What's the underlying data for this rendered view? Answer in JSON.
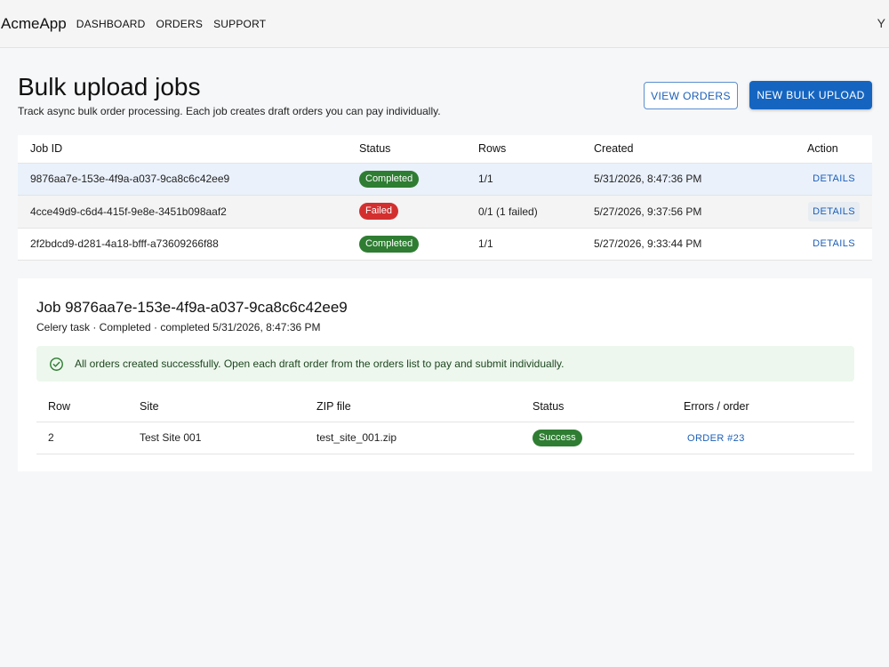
{
  "app": {
    "brand": "AcmeApp",
    "nav": [
      "DASHBOARD",
      "ORDERS",
      "SUPPORT"
    ],
    "user_initial": "Y"
  },
  "header": {
    "title": "Bulk upload jobs",
    "subtitle": "Track async bulk order processing. Each job creates draft orders you can pay individually.",
    "view_orders_label": "VIEW ORDERS",
    "new_bulk_upload_label": "NEW BULK UPLOAD"
  },
  "jobs_table": {
    "columns": [
      "Job ID",
      "Status",
      "Rows",
      "Created",
      "Action"
    ],
    "rows": [
      {
        "job_id": "9876aa7e-153e-4f9a-a037-9ca8c6c42ee9",
        "status": "Completed",
        "rows": "1/1",
        "created": "5/31/2026, 8:47:36 PM",
        "action": "DETAILS"
      },
      {
        "job_id": "4cce49d9-c6d4-415f-9e8e-3451b098aaf2",
        "status": "Failed",
        "rows": "0/1 (1 failed)",
        "created": "5/27/2026, 9:37:56 PM",
        "action": "DETAILS"
      },
      {
        "job_id": "2f2bdcd9-d281-4a18-bfff-a73609266f88",
        "status": "Completed",
        "rows": "1/1",
        "created": "5/27/2026, 9:33:44 PM",
        "action": "DETAILS"
      }
    ]
  },
  "job_detail": {
    "title": "Job 9876aa7e-153e-4f9a-a037-9ca8c6c42ee9",
    "meta": "Celery task · Completed · completed 5/31/2026, 8:47:36 PM",
    "alert": "All orders created successfully. Open each draft order from the orders list to pay and submit individually.",
    "columns": [
      "Row",
      "Site",
      "ZIP file",
      "Status",
      "Errors / order"
    ],
    "rows": [
      {
        "row": "2",
        "site": "Test Site 001",
        "zip": "test_site_001.zip",
        "status": "Success",
        "order": "ORDER #23"
      }
    ]
  },
  "colors": {
    "primary": "#1565c0",
    "success": "#2e7d32",
    "error": "#d32f2f",
    "alert_bg": "#edf7ed"
  }
}
